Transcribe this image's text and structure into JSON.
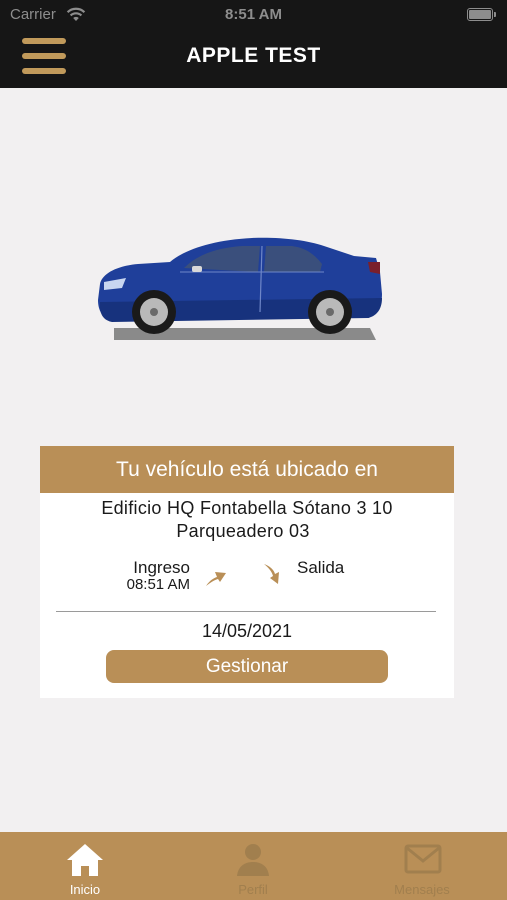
{
  "status_bar": {
    "carrier": "Carrier",
    "time": "8:51 AM"
  },
  "nav": {
    "title": "APPLE TEST",
    "menu_icon": "hamburger-icon"
  },
  "colors": {
    "accent": "#b98f57",
    "header_bg": "#161616",
    "car_body": "#1f3f9a"
  },
  "vehicle_card": {
    "header": "Tu vehículo está ubicado en",
    "location_line1": "Edificio HQ Fontabella Sótano 3 10",
    "location_line2": "Parqueadero 03",
    "ingreso_label": "Ingreso",
    "ingreso_time": "08:51 AM",
    "salida_label": "Salida",
    "date": "14/05/2021",
    "manage_button": "Gestionar"
  },
  "tabs": [
    {
      "label": "Inicio",
      "icon": "home-icon",
      "active": true
    },
    {
      "label": "Perfil",
      "icon": "profile-icon",
      "active": false
    },
    {
      "label": "Mensajes",
      "icon": "mail-icon",
      "active": false
    }
  ]
}
